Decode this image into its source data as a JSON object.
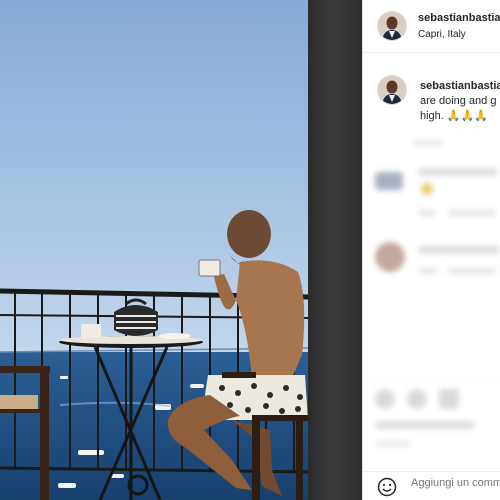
{
  "post": {
    "username": "sebastianbastian",
    "location": "Capri, Italy",
    "caption_line1": "are doing and g",
    "caption_line2": "high. 🙏🙏🙏"
  },
  "comment_box": {
    "placeholder": "Aggiungi un commento..."
  },
  "colors": {
    "sky_top": "#8fb2d9",
    "sky_bottom": "#b9d0e8",
    "sea": "#1f4f86",
    "panel_bg": "#ffffff"
  }
}
